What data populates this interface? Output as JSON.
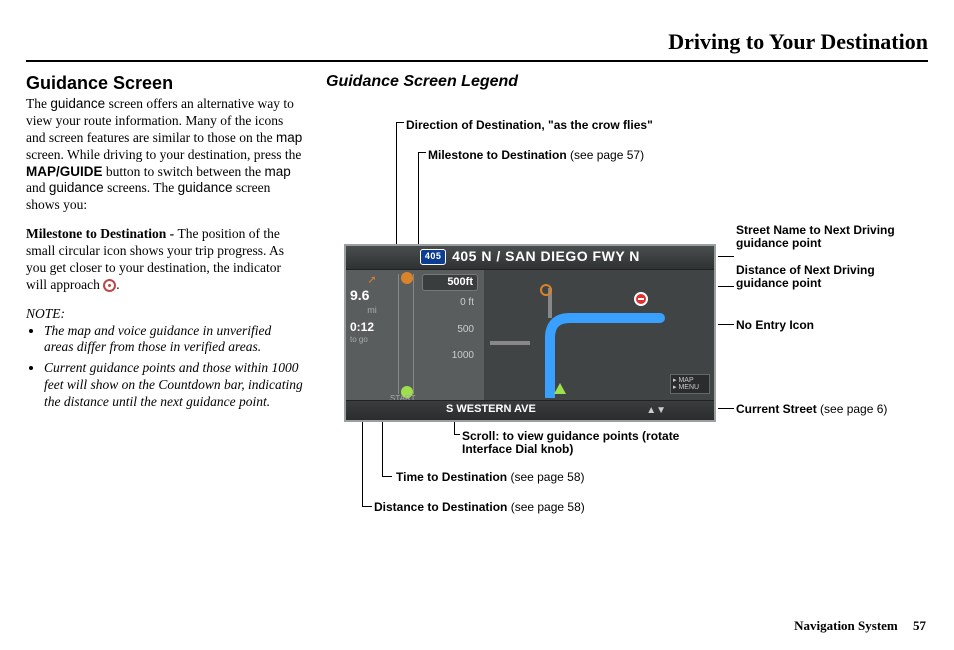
{
  "header": {
    "title": "Driving to Your Destination"
  },
  "left": {
    "heading": "Guidance Screen",
    "para1_a": "The ",
    "para1_g1": "guidance",
    "para1_b": " screen offers an alternative way to view your route information. Many of the icons and screen features are similar to those on the ",
    "para1_map": "map",
    "para1_c": " screen. While driving to your destination, press the ",
    "para1_btn": "MAP/GUIDE",
    "para1_d": " button to switch between the ",
    "para1_map2": "map",
    "para1_e": " and ",
    "para1_g2": "guidance",
    "para1_f": " screens. The ",
    "para1_g3": "guidance",
    "para1_g": " screen shows you:",
    "milestone_label": "Milestone to Destination - ",
    "milestone_text": "The position of the small circular icon shows your trip progress. As you get closer to your destination, the indicator will approach ",
    "milestone_end": ".",
    "note_label": "NOTE:",
    "note1": "The map and voice guidance in unverified areas differ from those in verified areas.",
    "note2": "Current guidance points and those within 1000 feet will show on the Countdown bar, indicating the distance until the next guidance point."
  },
  "right": {
    "legend_title": "Guidance Screen Legend",
    "callouts": {
      "direction": "Direction of Destination, \"as the crow flies\"",
      "milestone": "Milestone to Destination",
      "milestone_ref": " (see page 57)",
      "street_name": "Street Name to Next Driving guidance point",
      "dist_next": "Distance of Next Driving guidance point",
      "no_entry": "No Entry Icon",
      "current_street": "Current Street",
      "current_street_ref": " (see page 6)",
      "scroll": "Scroll: to view guidance points (rotate Interface Dial knob)",
      "time": "Time to Destination",
      "time_ref": " (see page 58)",
      "distance": "Distance to Destination",
      "distance_ref": " (see page 58)"
    }
  },
  "nav": {
    "street_top": "405 N / SAN DIEGO FWY N",
    "shield": "405",
    "miles": "9.6",
    "mi": "mi",
    "time": "0:12",
    "togo": "to go",
    "start": "START",
    "c500ft": "500ft",
    "c0ft": "0 ft",
    "c500": "500",
    "c1000": "1000",
    "bottom_street": "S WESTERN AVE",
    "map_btn_l1": "▸ MAP",
    "map_btn_l2": "▸ MENU",
    "scroll_icon": "▲▼"
  },
  "footer": {
    "label": "Navigation System",
    "page": "57"
  }
}
